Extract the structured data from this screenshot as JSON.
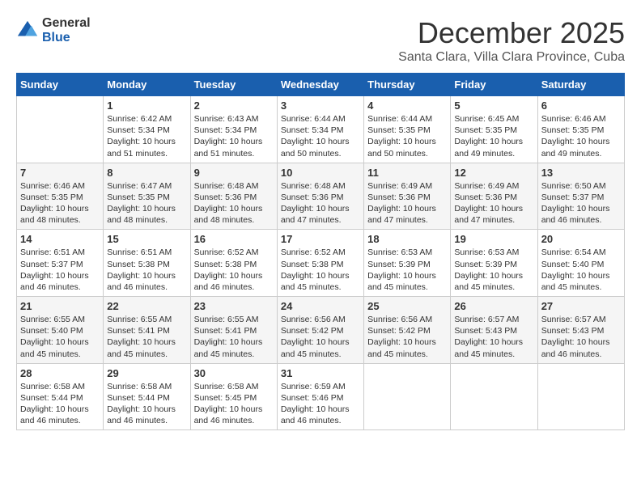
{
  "logo": {
    "general": "General",
    "blue": "Blue"
  },
  "header": {
    "month": "December 2025",
    "location": "Santa Clara, Villa Clara Province, Cuba"
  },
  "weekdays": [
    "Sunday",
    "Monday",
    "Tuesday",
    "Wednesday",
    "Thursday",
    "Friday",
    "Saturday"
  ],
  "weeks": [
    [
      {
        "day": "",
        "sunrise": "",
        "sunset": "",
        "daylight": ""
      },
      {
        "day": "1",
        "sunrise": "Sunrise: 6:42 AM",
        "sunset": "Sunset: 5:34 PM",
        "daylight": "Daylight: 10 hours and 51 minutes."
      },
      {
        "day": "2",
        "sunrise": "Sunrise: 6:43 AM",
        "sunset": "Sunset: 5:34 PM",
        "daylight": "Daylight: 10 hours and 51 minutes."
      },
      {
        "day": "3",
        "sunrise": "Sunrise: 6:44 AM",
        "sunset": "Sunset: 5:34 PM",
        "daylight": "Daylight: 10 hours and 50 minutes."
      },
      {
        "day": "4",
        "sunrise": "Sunrise: 6:44 AM",
        "sunset": "Sunset: 5:35 PM",
        "daylight": "Daylight: 10 hours and 50 minutes."
      },
      {
        "day": "5",
        "sunrise": "Sunrise: 6:45 AM",
        "sunset": "Sunset: 5:35 PM",
        "daylight": "Daylight: 10 hours and 49 minutes."
      },
      {
        "day": "6",
        "sunrise": "Sunrise: 6:46 AM",
        "sunset": "Sunset: 5:35 PM",
        "daylight": "Daylight: 10 hours and 49 minutes."
      }
    ],
    [
      {
        "day": "7",
        "sunrise": "Sunrise: 6:46 AM",
        "sunset": "Sunset: 5:35 PM",
        "daylight": "Daylight: 10 hours and 48 minutes."
      },
      {
        "day": "8",
        "sunrise": "Sunrise: 6:47 AM",
        "sunset": "Sunset: 5:35 PM",
        "daylight": "Daylight: 10 hours and 48 minutes."
      },
      {
        "day": "9",
        "sunrise": "Sunrise: 6:48 AM",
        "sunset": "Sunset: 5:36 PM",
        "daylight": "Daylight: 10 hours and 48 minutes."
      },
      {
        "day": "10",
        "sunrise": "Sunrise: 6:48 AM",
        "sunset": "Sunset: 5:36 PM",
        "daylight": "Daylight: 10 hours and 47 minutes."
      },
      {
        "day": "11",
        "sunrise": "Sunrise: 6:49 AM",
        "sunset": "Sunset: 5:36 PM",
        "daylight": "Daylight: 10 hours and 47 minutes."
      },
      {
        "day": "12",
        "sunrise": "Sunrise: 6:49 AM",
        "sunset": "Sunset: 5:36 PM",
        "daylight": "Daylight: 10 hours and 47 minutes."
      },
      {
        "day": "13",
        "sunrise": "Sunrise: 6:50 AM",
        "sunset": "Sunset: 5:37 PM",
        "daylight": "Daylight: 10 hours and 46 minutes."
      }
    ],
    [
      {
        "day": "14",
        "sunrise": "Sunrise: 6:51 AM",
        "sunset": "Sunset: 5:37 PM",
        "daylight": "Daylight: 10 hours and 46 minutes."
      },
      {
        "day": "15",
        "sunrise": "Sunrise: 6:51 AM",
        "sunset": "Sunset: 5:38 PM",
        "daylight": "Daylight: 10 hours and 46 minutes."
      },
      {
        "day": "16",
        "sunrise": "Sunrise: 6:52 AM",
        "sunset": "Sunset: 5:38 PM",
        "daylight": "Daylight: 10 hours and 46 minutes."
      },
      {
        "day": "17",
        "sunrise": "Sunrise: 6:52 AM",
        "sunset": "Sunset: 5:38 PM",
        "daylight": "Daylight: 10 hours and 45 minutes."
      },
      {
        "day": "18",
        "sunrise": "Sunrise: 6:53 AM",
        "sunset": "Sunset: 5:39 PM",
        "daylight": "Daylight: 10 hours and 45 minutes."
      },
      {
        "day": "19",
        "sunrise": "Sunrise: 6:53 AM",
        "sunset": "Sunset: 5:39 PM",
        "daylight": "Daylight: 10 hours and 45 minutes."
      },
      {
        "day": "20",
        "sunrise": "Sunrise: 6:54 AM",
        "sunset": "Sunset: 5:40 PM",
        "daylight": "Daylight: 10 hours and 45 minutes."
      }
    ],
    [
      {
        "day": "21",
        "sunrise": "Sunrise: 6:55 AM",
        "sunset": "Sunset: 5:40 PM",
        "daylight": "Daylight: 10 hours and 45 minutes."
      },
      {
        "day": "22",
        "sunrise": "Sunrise: 6:55 AM",
        "sunset": "Sunset: 5:41 PM",
        "daylight": "Daylight: 10 hours and 45 minutes."
      },
      {
        "day": "23",
        "sunrise": "Sunrise: 6:55 AM",
        "sunset": "Sunset: 5:41 PM",
        "daylight": "Daylight: 10 hours and 45 minutes."
      },
      {
        "day": "24",
        "sunrise": "Sunrise: 6:56 AM",
        "sunset": "Sunset: 5:42 PM",
        "daylight": "Daylight: 10 hours and 45 minutes."
      },
      {
        "day": "25",
        "sunrise": "Sunrise: 6:56 AM",
        "sunset": "Sunset: 5:42 PM",
        "daylight": "Daylight: 10 hours and 45 minutes."
      },
      {
        "day": "26",
        "sunrise": "Sunrise: 6:57 AM",
        "sunset": "Sunset: 5:43 PM",
        "daylight": "Daylight: 10 hours and 45 minutes."
      },
      {
        "day": "27",
        "sunrise": "Sunrise: 6:57 AM",
        "sunset": "Sunset: 5:43 PM",
        "daylight": "Daylight: 10 hours and 46 minutes."
      }
    ],
    [
      {
        "day": "28",
        "sunrise": "Sunrise: 6:58 AM",
        "sunset": "Sunset: 5:44 PM",
        "daylight": "Daylight: 10 hours and 46 minutes."
      },
      {
        "day": "29",
        "sunrise": "Sunrise: 6:58 AM",
        "sunset": "Sunset: 5:44 PM",
        "daylight": "Daylight: 10 hours and 46 minutes."
      },
      {
        "day": "30",
        "sunrise": "Sunrise: 6:58 AM",
        "sunset": "Sunset: 5:45 PM",
        "daylight": "Daylight: 10 hours and 46 minutes."
      },
      {
        "day": "31",
        "sunrise": "Sunrise: 6:59 AM",
        "sunset": "Sunset: 5:46 PM",
        "daylight": "Daylight: 10 hours and 46 minutes."
      },
      {
        "day": "",
        "sunrise": "",
        "sunset": "",
        "daylight": ""
      },
      {
        "day": "",
        "sunrise": "",
        "sunset": "",
        "daylight": ""
      },
      {
        "day": "",
        "sunrise": "",
        "sunset": "",
        "daylight": ""
      }
    ]
  ]
}
